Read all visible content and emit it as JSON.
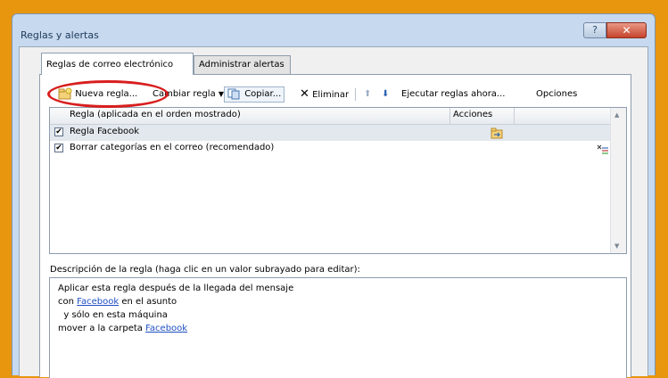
{
  "window": {
    "title": "Reglas y alertas",
    "help_label": "?",
    "close_label": "✕"
  },
  "tabs": [
    {
      "label": "Reglas de correo electrónico",
      "active": true
    },
    {
      "label": "Administrar alertas",
      "active": false
    }
  ],
  "toolbar": {
    "new_rule_label": "Nueva regla...",
    "change_rule_label": "Cambiar regla",
    "copy_label": "Copiar...",
    "delete_label": "Eliminar",
    "run_rules_label": "Ejecutar reglas ahora...",
    "options_label": "Opciones"
  },
  "rules_list": {
    "column_rule": "Regla (aplicada en el orden mostrado)",
    "column_actions": "Acciones",
    "rows": [
      {
        "checked": true,
        "name": "Regla Facebook",
        "action_icon": "folder-move-icon",
        "selected": true
      },
      {
        "checked": true,
        "name": "Borrar categorías en el correo (recomendado)",
        "action_icon": "clear-categories-icon",
        "selected": false
      }
    ]
  },
  "description": {
    "label": "Descripción de la regla (haga clic en un valor subrayado para editar):",
    "line1": "Aplicar esta regla después de la llegada del mensaje",
    "line2_prefix": "con ",
    "line2_link": "Facebook",
    "line2_suffix": " en el asunto",
    "line3": "  y sólo en esta máquina",
    "line4_prefix": "mover a la carpeta ",
    "line4_link": "Facebook"
  },
  "colors": {
    "background_frame": "#e8960e",
    "highlight_oval": "#d81e1e",
    "link": "#1f4fc2"
  }
}
